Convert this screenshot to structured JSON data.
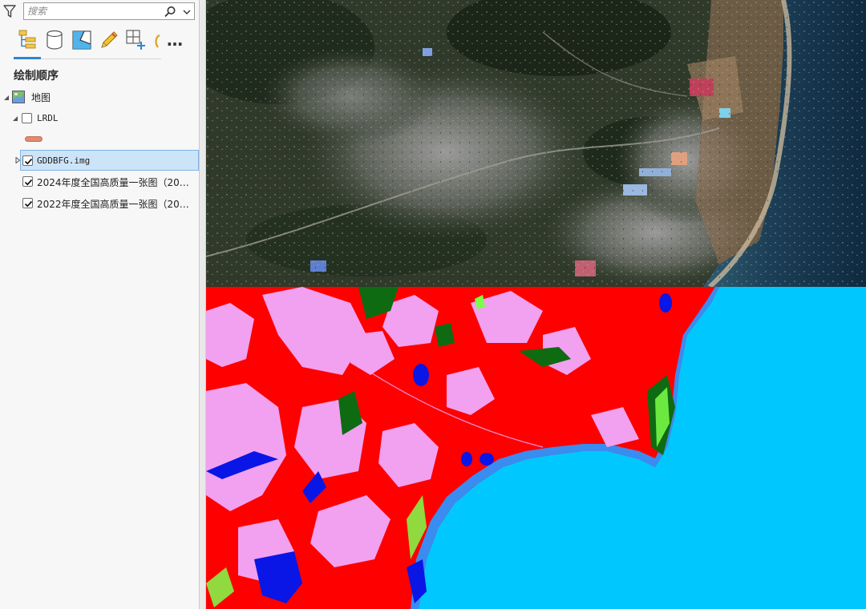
{
  "search": {
    "placeholder": "搜索"
  },
  "toolbar": {
    "icons": [
      "list-by-drawing-order-icon",
      "list-by-source-icon",
      "list-by-selection-icon",
      "list-by-editing-icon",
      "list-by-snapping-icon",
      "list-by-labeling-icon"
    ],
    "more_label": "…"
  },
  "section": {
    "title": "绘制顺序"
  },
  "layers": {
    "map": {
      "label": "地图"
    },
    "group": {
      "label": "LRDL",
      "checked": false
    },
    "symbol_color": "#e08a6e",
    "items": [
      {
        "label": "GDDBFG.img",
        "checked": true,
        "selected": true
      },
      {
        "label": "2024年度全国高质量一张图（20…",
        "checked": true
      },
      {
        "label": "2022年度全国高质量一张图（20…",
        "checked": true
      }
    ]
  },
  "classification_colors": {
    "sea": "#00c8ff",
    "built_up": "#ff0000",
    "cropland": "#f2a0f0",
    "forest": "#0e6b12",
    "water": "#0a16e6",
    "grass": "#7cff4a",
    "shore": "#3a8cf0"
  }
}
